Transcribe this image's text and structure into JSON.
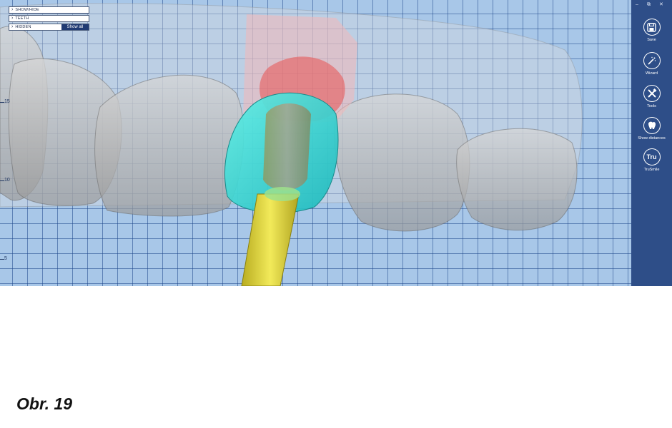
{
  "panel": {
    "rows": [
      {
        "label": "SHOW/HIDE"
      },
      {
        "label": "TEETH"
      },
      {
        "label": "HIDDEN"
      }
    ],
    "show_all_label": "Show all"
  },
  "window_controls": {
    "minimize": "–",
    "restore": "⧉",
    "close": "✕"
  },
  "toolbar": {
    "save_label": "Save",
    "wizard_label": "Wizard",
    "tools_label": "Tools",
    "distances_label": "Show distances",
    "trusmile_label": "TruSmile",
    "trusmile_icon_text": "Tru"
  },
  "ruler": {
    "labels": [
      "15",
      "10",
      "5"
    ]
  },
  "caption": "Obr. 19",
  "colors": {
    "sidebar": "#2e4e88",
    "grid_bg": "#a8c7e8",
    "implant": "#e8e050",
    "crown": "#3fd6d0",
    "gingiva": "#f0a8a8"
  }
}
